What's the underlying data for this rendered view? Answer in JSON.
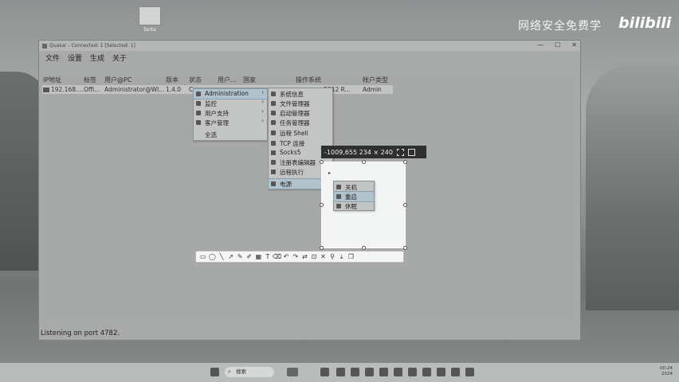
{
  "desktop": {
    "icon_label": "fanta",
    "watermark": "网络安全免费学",
    "watermark_logo": "bilibili"
  },
  "window": {
    "title": "Quasar - Connected: 1 [Selected: 1]",
    "controls": [
      "—",
      "☐",
      "✕"
    ],
    "menu": [
      "文件",
      "设置",
      "生成",
      "关于"
    ],
    "columns": [
      "IP地址",
      "标签",
      "用户@PC",
      "版本",
      "状态",
      "用户...",
      "国家",
      "操作系统",
      "帐户类型"
    ],
    "row": [
      "192.168....",
      "Offi...",
      "Administrator@WI...",
      "1.4.0",
      "C...",
      "",
      "",
      "...2012 R...",
      "Admin"
    ],
    "status": "Listening on port 4782."
  },
  "context_menu": {
    "items": [
      {
        "label": "Administration",
        "icon": "admin-icon",
        "submenu": true
      },
      {
        "label": "监控",
        "icon": "monitor-icon",
        "submenu": true
      },
      {
        "label": "用户支持",
        "icon": "user-icon",
        "submenu": true
      },
      {
        "label": "客户管理",
        "icon": "client-icon",
        "submenu": true
      },
      {
        "label": "全选",
        "icon": "",
        "submenu": false
      }
    ]
  },
  "admin_submenu": {
    "items": [
      {
        "label": "系统信息",
        "icon": "info-icon"
      },
      {
        "label": "文件管理器",
        "icon": "folder-icon"
      },
      {
        "label": "启动管理器",
        "icon": "startup-icon"
      },
      {
        "label": "任务管理器",
        "icon": "task-icon"
      },
      {
        "label": "远程 Shell",
        "icon": "terminal-icon"
      },
      {
        "label": "TCP 连接",
        "icon": "network-icon"
      },
      {
        "label": "Socks5",
        "icon": "socks-icon"
      },
      {
        "label": "注册表编辑器",
        "icon": "registry-icon"
      },
      {
        "label": "远程执行",
        "icon": "execute-icon"
      },
      {
        "label": "电源",
        "icon": "power-icon"
      }
    ]
  },
  "power_submenu": {
    "items": [
      "关机",
      "重启",
      "休眠"
    ]
  },
  "snip": {
    "readout": "-1009,655  234 × 240"
  },
  "snip_tools": [
    "rect",
    "ellipse",
    "line",
    "arrow",
    "pen",
    "marker",
    "mosaic",
    "text",
    "eraser",
    "undo",
    "redo",
    "translate",
    "ocr",
    "close",
    "pin",
    "save",
    "copy"
  ],
  "taskbar": {
    "search_label": "搜索",
    "time": "00:24",
    "date": "2024"
  }
}
